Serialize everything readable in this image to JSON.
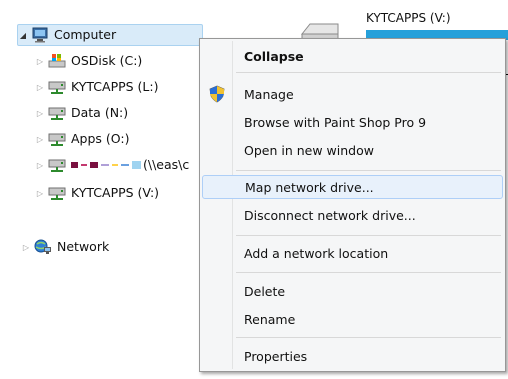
{
  "tree": {
    "items": [
      {
        "label": "Computer",
        "icon": "computer-icon"
      },
      {
        "label": "OSDisk (C:)",
        "icon": "windows-drive-icon"
      },
      {
        "label": "KYTCAPPS (L:)",
        "icon": "network-drive-icon"
      },
      {
        "label": "Data (N:)",
        "icon": "network-drive-icon"
      },
      {
        "label": "Apps (O:)",
        "icon": "network-drive-icon"
      },
      {
        "label": "(\\\\eas\\c",
        "icon": "network-drive-icon"
      },
      {
        "label": "KYTCAPPS (V:)",
        "icon": "network-drive-icon"
      },
      {
        "label": "Network",
        "icon": "network-icon"
      }
    ]
  },
  "drive_panel": {
    "title": "KYTCAPPS (V:)",
    "bar_color": "#26a0da"
  },
  "menu": {
    "items": [
      {
        "label": "Collapse",
        "bold": true
      },
      {
        "label": "Manage",
        "icon": "shield-icon"
      },
      {
        "label": "Browse with Paint Shop Pro 9"
      },
      {
        "label": "Open in new window"
      },
      {
        "label": "Map network drive...",
        "highlighted": true
      },
      {
        "label": "Disconnect network drive..."
      },
      {
        "label": "Add a network location"
      },
      {
        "label": "Delete"
      },
      {
        "label": "Rename"
      },
      {
        "label": "Properties"
      }
    ]
  }
}
